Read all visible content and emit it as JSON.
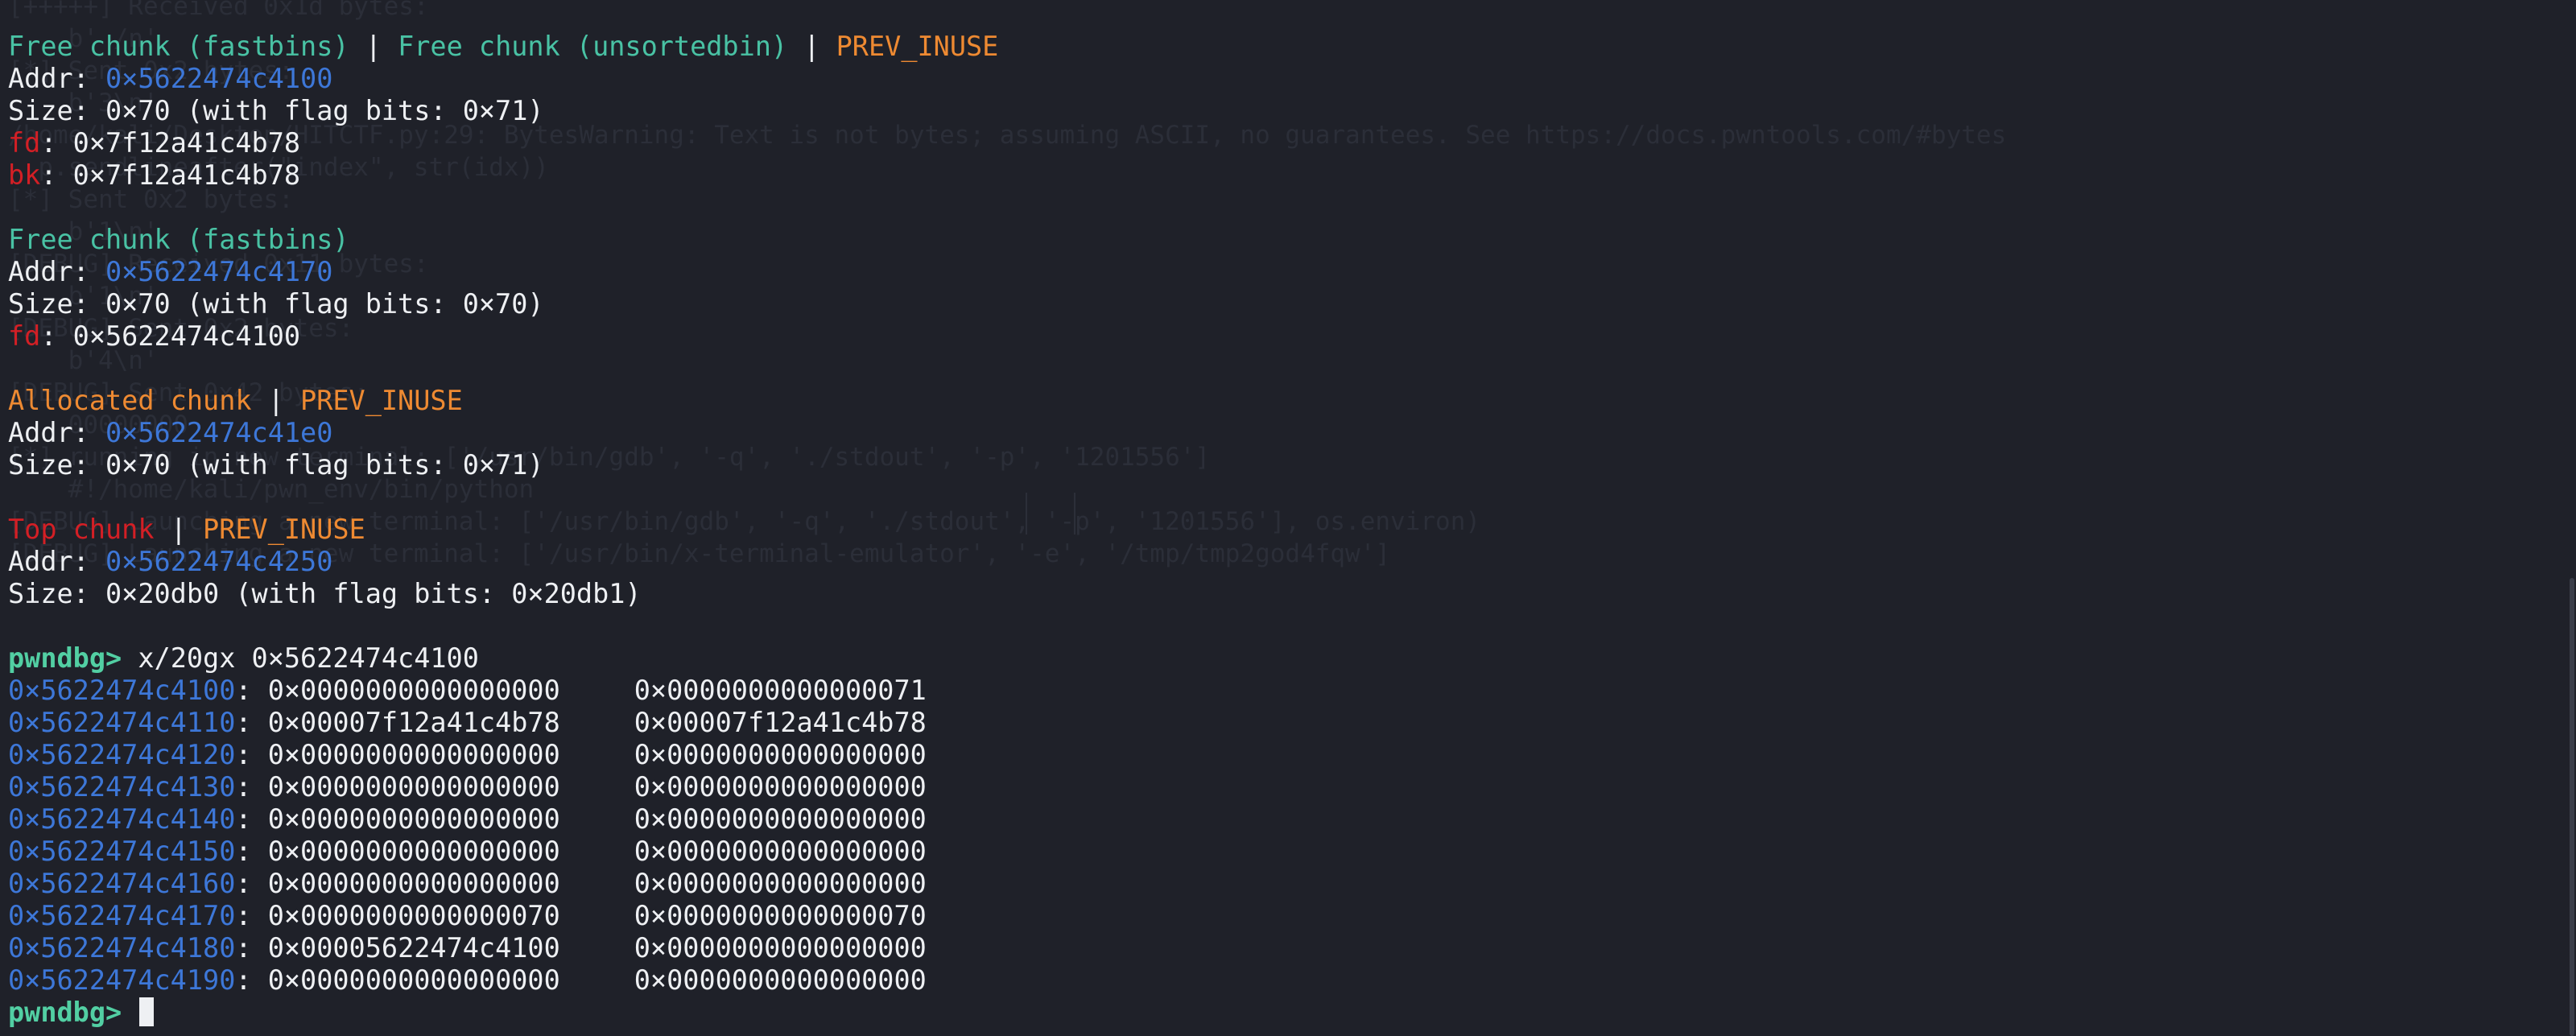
{
  "palette": {
    "background": "#1f2129",
    "text": "#eef0f3",
    "teal": "#49c2a4",
    "orange": "#ee8a32",
    "red": "#d31f25",
    "blue": "#3d77d8",
    "prompt": "#52cfa3"
  },
  "background_ghost_text": [
    "[+++++] Received 0x1d bytes:",
    "",
    "",
    "",
    "    b' /n'",
    "[*] Sent 0x2 bytes:",
    "    b'3\\n'",
    "/home/kali/Desktop/HITCTF.py:29: BytesWarning: Text is not bytes; assuming ASCII, no guarantees. See https://docs.pwntools.com/#bytes",
    "  p.sendlineafter(\"index\", str(idx))",
    "[*] Sent 0x2 bytes:",
    "    b'1\\n'",
    "[DEBUG] Received 0x11 bytes:",
    "    b'1\\n'",
    "[DEBUG] Sent 0x2 bytes:",
    "    b'4\\n'",
    "[DEBUG] Sent 0x42 bytes:",
    "    00000000",
    "",
    "[*] running in new terminal: ['/usr/bin/gdb', '-q', './stdout', '-p', '1201556']",
    "",
    "    #!/home/kali/pwn_env/bin/python",
    "",
    "[DEBUG] Launching a new terminal: ['/usr/bin/gdb', '-q', './stdout', '-p', '1201556'], os.environ)",
    "[DEBUG] Launching a new terminal: ['/usr/bin/x-terminal-emulator', '-e', '/tmp/tmp2god4fqw']"
  ],
  "heap_chunks": [
    {
      "title_parts": [
        {
          "text": "Free chunk (fastbins)",
          "color": "teal"
        },
        {
          "text": " | ",
          "color": "white"
        },
        {
          "text": "Free chunk (unsortedbin)",
          "color": "teal"
        },
        {
          "text": " | ",
          "color": "white"
        },
        {
          "text": "PREV_INUSE",
          "color": "orange"
        }
      ],
      "addr_label": "Addr: ",
      "addr": "0×5622474c4100",
      "size_text": "Size: 0×70 (with flag bits: 0×71)",
      "fields": [
        {
          "name": "fd",
          "value": ": 0×7f12a41c4b78"
        },
        {
          "name": "bk",
          "value": ": 0×7f12a41c4b78"
        }
      ]
    },
    {
      "title_parts": [
        {
          "text": "Free chunk (fastbins)",
          "color": "teal"
        }
      ],
      "addr_label": "Addr: ",
      "addr": "0×5622474c4170",
      "size_text": "Size: 0×70 (with flag bits: 0×70)",
      "fields": [
        {
          "name": "fd",
          "value": ": 0×5622474c4100"
        }
      ]
    },
    {
      "title_parts": [
        {
          "text": "Allocated chunk",
          "color": "orange"
        },
        {
          "text": " | ",
          "color": "white"
        },
        {
          "text": "PREV_INUSE",
          "color": "orange"
        }
      ],
      "addr_label": "Addr: ",
      "addr": "0×5622474c41e0",
      "size_text": "Size: 0×70 (with flag bits: 0×71)",
      "fields": []
    },
    {
      "title_parts": [
        {
          "text": "Top chunk",
          "color": "red"
        },
        {
          "text": " | ",
          "color": "white"
        },
        {
          "text": "PREV_INUSE",
          "color": "orange"
        }
      ],
      "addr_label": "Addr: ",
      "addr": "0×5622474c4250",
      "size_text": "Size: 0×20db0 (with flag bits: 0×20db1)",
      "fields": []
    }
  ],
  "command": {
    "prompt": "pwndbg>",
    "text": " x/20gx 0×5622474c4100"
  },
  "memory_dump": [
    {
      "addr": "0×5622474c4100",
      "v1": "0×0000000000000000",
      "v2": "0×0000000000000071"
    },
    {
      "addr": "0×5622474c4110",
      "v1": "0×00007f12a41c4b78",
      "v2": "0×00007f12a41c4b78"
    },
    {
      "addr": "0×5622474c4120",
      "v1": "0×0000000000000000",
      "v2": "0×0000000000000000"
    },
    {
      "addr": "0×5622474c4130",
      "v1": "0×0000000000000000",
      "v2": "0×0000000000000000"
    },
    {
      "addr": "0×5622474c4140",
      "v1": "0×0000000000000000",
      "v2": "0×0000000000000000"
    },
    {
      "addr": "0×5622474c4150",
      "v1": "0×0000000000000000",
      "v2": "0×0000000000000000"
    },
    {
      "addr": "0×5622474c4160",
      "v1": "0×0000000000000000",
      "v2": "0×0000000000000000"
    },
    {
      "addr": "0×5622474c4170",
      "v1": "0×0000000000000070",
      "v2": "0×0000000000000070"
    },
    {
      "addr": "0×5622474c4180",
      "v1": "0×00005622474c4100",
      "v2": "0×0000000000000000"
    },
    {
      "addr": "0×5622474c4190",
      "v1": "0×0000000000000000",
      "v2": "0×0000000000000000"
    }
  ],
  "final_prompt": "pwndbg>"
}
